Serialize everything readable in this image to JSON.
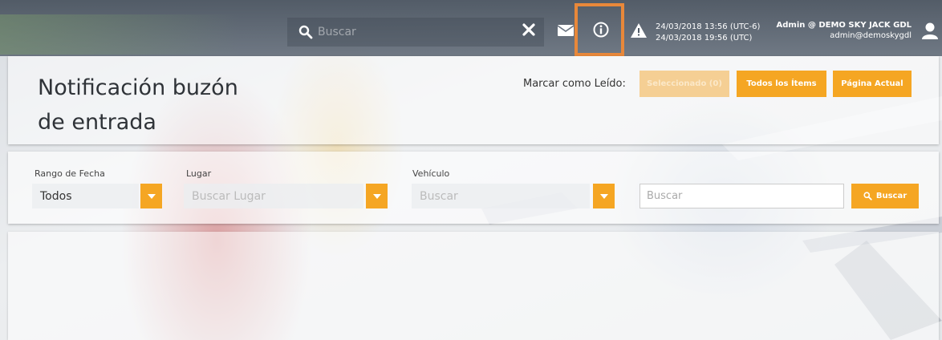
{
  "topbar": {
    "search_placeholder": "Buscar",
    "datetime_local": "24/03/2018 13:56 (UTC-6)",
    "datetime_utc": "24/03/2018 19:56 (UTC)",
    "user_name": "Admin @ DEMO SKY JACK GDL",
    "user_email": "admin@demoskygdl",
    "icons": [
      "search-icon",
      "close-icon",
      "mail-icon",
      "info-icon",
      "warning-icon",
      "user-icon"
    ]
  },
  "header": {
    "title_line1": "Notificación buzón",
    "title_line2": "de entrada",
    "mark_label": "Marcar como Leído:",
    "btn_selected": "Seleccionado (0)",
    "btn_all": "Todos los Ítems",
    "btn_page": "Página Actual"
  },
  "filters": {
    "date_label": "Rango de Fecha",
    "date_value": "Todos",
    "place_label": "Lugar",
    "place_placeholder": "Buscar Lugar",
    "vehicle_label": "Vehículo",
    "vehicle_placeholder": "Buscar",
    "search_placeholder": "Buscar",
    "search_button": "Buscar"
  },
  "colors": {
    "accent": "#f5a623",
    "highlight": "#e8883a",
    "topbar": "#4f5a66"
  }
}
